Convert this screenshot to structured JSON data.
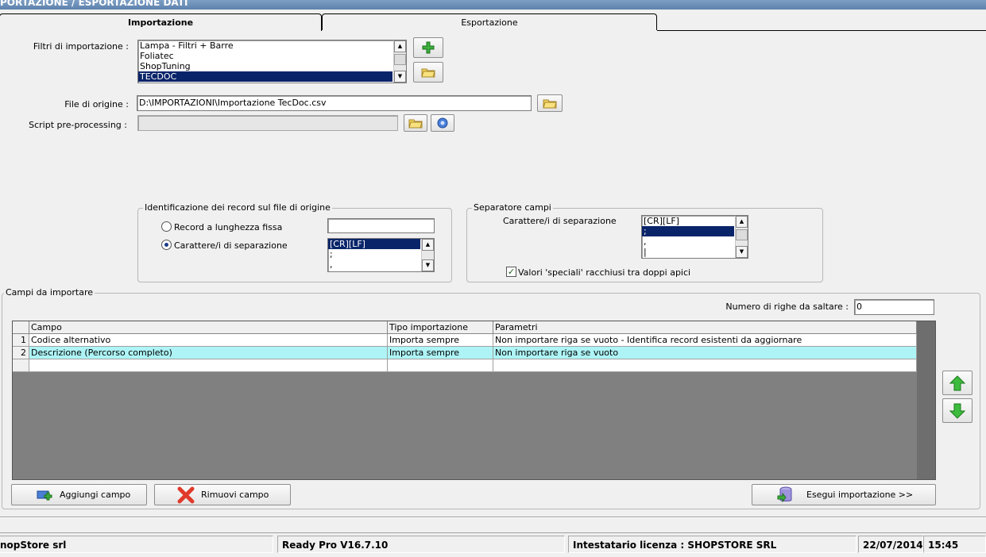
{
  "window": {
    "title": "PORTAZIONE / ESPORTAZIONE DATI"
  },
  "tabs": [
    {
      "label": "Importazione"
    },
    {
      "label": "Esportazione"
    }
  ],
  "filters": {
    "label": "Filtri di importazione :",
    "items": [
      "Lampa - Filtri + Barre",
      "Foliatec",
      "ShopTuning",
      "TECDOC"
    ],
    "selected": "TECDOC"
  },
  "source_file": {
    "label": "File di origine :",
    "value": "D:\\IMPORTAZIONI\\Importazione TecDoc.csv"
  },
  "script": {
    "label": "Script pre-processing :",
    "value": ""
  },
  "record_id": {
    "title": "Identificazione dei record sul file di origine",
    "option_fixed": "Record a lunghezza fissa",
    "option_sep": "Carattere/i di separazione",
    "selected": "Carattere/i di separazione",
    "fixed_value": "",
    "sep_items": [
      "[CR][LF]",
      ";",
      ","
    ],
    "sep_selected": "[CR][LF]"
  },
  "field_sep": {
    "title": "Separatore campi",
    "label": "Carattere/i di separazione",
    "items": [
      "[CR][LF]",
      ";",
      ",",
      "|"
    ],
    "selected": ";",
    "quotes_label": "Valori 'speciali' racchiusi tra doppi apici",
    "quotes_checked": true
  },
  "fields": {
    "title": "Campi da importare",
    "skip_label": "Numero di righe da saltare :",
    "skip_value": "0",
    "columns": [
      "Campo",
      "Tipo importazione",
      "Parametri"
    ],
    "rows": [
      {
        "num": "1",
        "campo": "Codice alternativo",
        "tipo": "Importa sempre",
        "parametri": "Non importare riga se vuoto - Identifica record esistenti da aggiornare"
      },
      {
        "num": "2",
        "campo": "Descrizione (Percorso completo)",
        "tipo": "Importa sempre",
        "parametri": "Non importare riga se vuoto"
      }
    ],
    "selected_row": "2"
  },
  "buttons": {
    "add_field": "Aggiungi campo",
    "remove_field": "Rimuovi campo",
    "run_import": "Esegui importazione >>"
  },
  "status": {
    "company": "nopStore srl",
    "version": "Ready Pro V16.7.10",
    "license": "Intestatario licenza : SHOPSTORE SRL",
    "date": "22/07/2014",
    "time": "15:45"
  },
  "colors": {
    "selection": "#0a246a",
    "row_highlight": "#aef4f6",
    "grid_bg": "#808080",
    "titlebar": "#6b8db6"
  }
}
